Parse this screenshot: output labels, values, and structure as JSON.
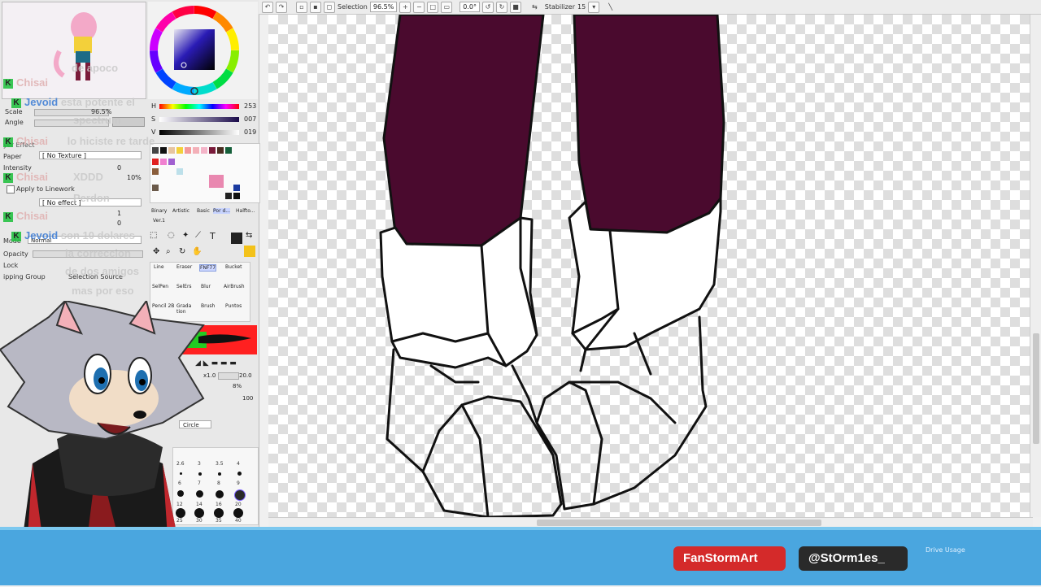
{
  "toolbar": {
    "selection_label": "Selection",
    "zoom_value": "96.5%",
    "angle_value": "0.0°",
    "stabilizer_label": "Stabilizer",
    "stabilizer_value": "15"
  },
  "color": {
    "h_label": "H",
    "h_value": "253",
    "s_label": "S",
    "s_value": "007",
    "v_label": "V",
    "v_value": "019",
    "current": "#1a1420"
  },
  "navigator": {
    "scale_label": "Scale",
    "scale_value": "96.5%",
    "angle_label": "Angle"
  },
  "layer_props": {
    "effect_label": "yer Effect",
    "paper_label": "Paper",
    "paper_value": "[ No Texture ]",
    "intensity_label": "Intensity",
    "intensity_value": "0",
    "size_value": "10%",
    "apply_linework": "Apply to Linework",
    "effect_select": "[ No effect ]",
    "width_value": "1",
    "intensity2_value": "0",
    "mode_label": "Mode",
    "mode_value": "Normal",
    "opacity_label": "Opacity",
    "lock_label": "Lock",
    "clipping_label": "ipping Group",
    "selection_source": "Selection Source"
  },
  "brush_tabs": [
    "Binary",
    "Artistic",
    "Basic",
    "Por d...",
    "Halfto..."
  ],
  "version": "Ver.1",
  "tools": [
    "Line",
    "Eraser",
    "FNF77",
    "Bucket",
    "SelPen",
    "SelErs",
    "Blur",
    "AirBrush",
    "Pencil 2B",
    "Grada tion",
    "Brush",
    "Puntos"
  ],
  "brush_size": {
    "multiplier": "x1.0",
    "value": "20.0",
    "min_size": "8%",
    "density": "100"
  },
  "brush_shape": "Circle",
  "brush_sizes": [
    "2.6",
    "3",
    "3.5",
    "4",
    "6",
    "7",
    "8",
    "9",
    "12",
    "14",
    "16",
    "20",
    "25",
    "30",
    "35",
    "40"
  ],
  "chat": [
    {
      "user": "Chisai",
      "msg": "de apoco"
    },
    {
      "user": "Jevoid",
      "msg": "esta potente el"
    },
    {
      "user": "",
      "msg": "spectrum"
    },
    {
      "user": "Chisai",
      "msg": "lo hiciste re tarde"
    },
    {
      "user": "",
      "msg": "XDDD"
    },
    {
      "user": "Chisai",
      "msg": "Perdon"
    },
    {
      "user": "Chisai",
      "msg": ""
    },
    {
      "user": "Jevoid",
      "msg": "son 10 dolares"
    },
    {
      "user": "",
      "msg": "la correccion"
    },
    {
      "user": "",
      "msg": "de dos amigos"
    },
    {
      "user": "",
      "msg": "mas por eso"
    }
  ],
  "socials": {
    "twitch": "FanStormArt",
    "twitter": "@StOrm1es_"
  },
  "status": {
    "drive_usage": "Drive Usage"
  }
}
